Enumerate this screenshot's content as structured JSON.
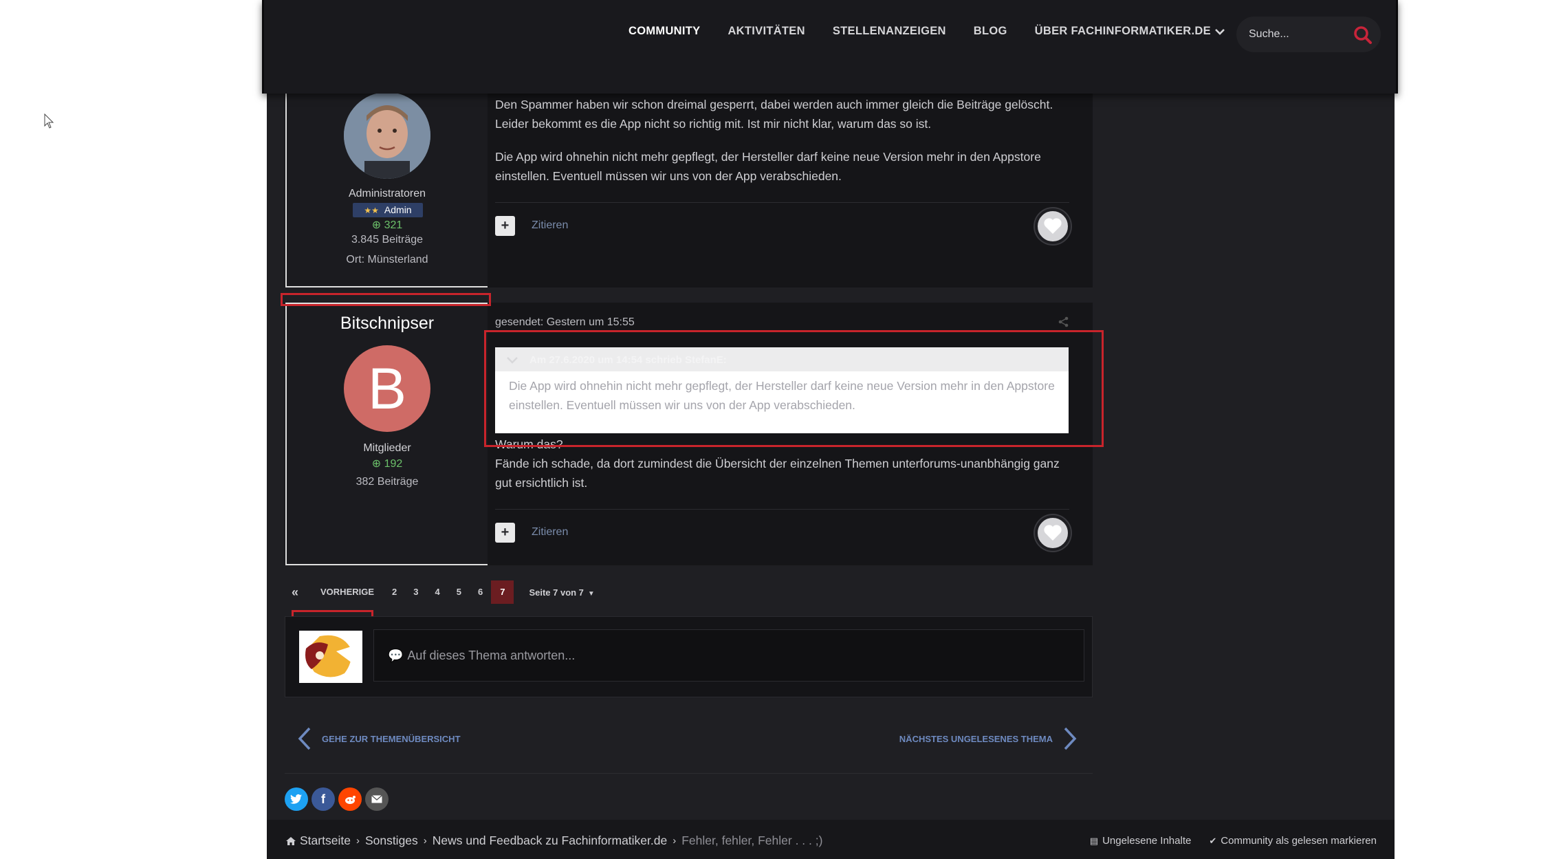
{
  "nav": {
    "items": [
      {
        "label": "COMMUNITY",
        "active": true
      },
      {
        "label": "AKTIVITÄTEN",
        "active": false
      },
      {
        "label": "STELLENANZEIGEN",
        "active": false
      },
      {
        "label": "BLOG",
        "active": false
      },
      {
        "label": "ÜBER FACHINFORMATIKER.DE",
        "active": false,
        "dropdown": true
      }
    ],
    "search_placeholder": "Suche..."
  },
  "posts": [
    {
      "author_group": "Administratoren",
      "badge": "Admin",
      "reputation": "321",
      "post_count": "3.845 Beiträge",
      "location": "Ort: Münsterland",
      "paragraphs": [
        "Den Spammer haben wir schon dreimal gesperrt, dabei werden auch immer gleich die Beiträge gelöscht. Leider bekommt es die App nicht so richtig mit. Ist mir nicht klar, warum das so ist.",
        "Die App wird ohnehin nicht mehr gepflegt, der Hersteller darf keine neue Version mehr in den Appstore einstellen. Eventuell müssen wir uns von der App verabschieden."
      ],
      "quote_label": "Zitieren"
    },
    {
      "author_name": "Bitschnipser",
      "avatar_letter": "B",
      "author_group": "Mitglieder",
      "reputation": "192",
      "post_count": "382 Beiträge",
      "meta": "gesendet: Gestern um 15:55",
      "quote_header": "Am 27.6.2020 um 14:54 schrieb StefanE:",
      "quote_text": "Die App wird ohnehin nicht mehr gepflegt, der Hersteller darf keine neue Version mehr in den Appstore einstellen. Eventuell müssen wir uns von der App verabschieden.",
      "line1": "Warum das?",
      "line2": "Fände ich schade, da dort zumindest die Übersicht der einzelnen Themen unterforums-unanbhängig ganz gut ersichtlich ist.",
      "quote_label": "Zitieren"
    }
  ],
  "pagination": {
    "first": "«",
    "prev": "VORHERIGE",
    "pages": [
      "2",
      "3",
      "4",
      "5",
      "6",
      "7"
    ],
    "current": "7",
    "info": "Seite 7 von 7"
  },
  "reply": {
    "placeholder": "Auf dieses Thema antworten..."
  },
  "topic_nav": {
    "prev_label": "GEHE ZUR THEMENÜBERSICHT",
    "next_label": "NÄCHSTES UNGELESENES THEMA"
  },
  "share": {
    "icons": [
      "twitter-icon",
      "facebook-icon",
      "reddit-icon",
      "email-icon"
    ],
    "colors": {
      "twitter": "#1da1f2",
      "facebook": "#3b5998",
      "reddit": "#ff4500",
      "email": "#555555"
    }
  },
  "breadcrumb": {
    "items": [
      "Startseite",
      "Sonstiges",
      "News und Feedback zu Fachinformatiker.de"
    ],
    "current": "Fehler, fehler, Fehler . . . ;)"
  },
  "footer": {
    "unread": "Ungelesene Inhalte",
    "mark_read": "Community als gelesen markieren"
  },
  "colors": {
    "accent_red": "#c8242b",
    "page_bg": "#1f1f23",
    "link_blue": "#6e8ac0"
  }
}
